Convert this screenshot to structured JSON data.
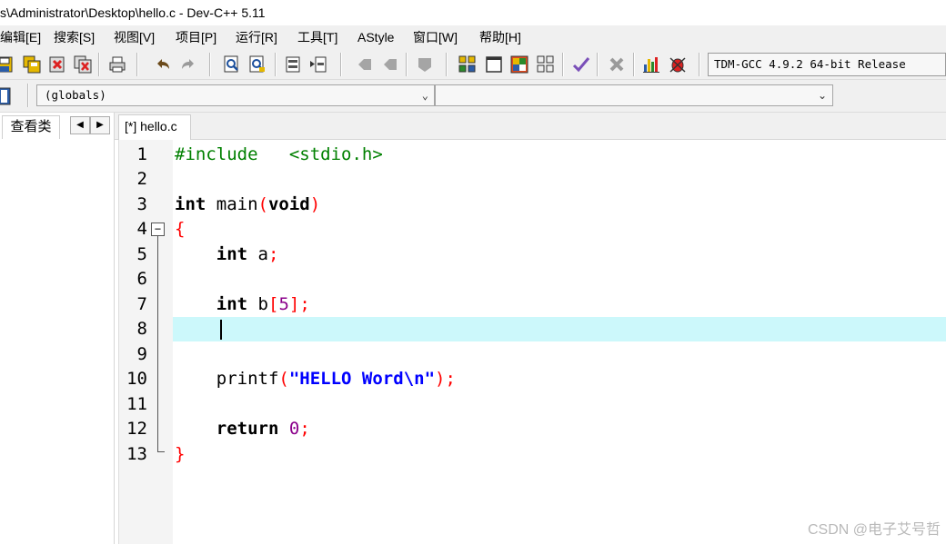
{
  "window": {
    "title": "s\\Administrator\\Desktop\\hello.c - Dev-C++ 5.11"
  },
  "menu": [
    "编辑[E]",
    "搜索[S]",
    "视图[V]",
    "项目[P]",
    "运行[R]",
    "工具[T]",
    "AStyle",
    "窗口[W]",
    "帮助[H]"
  ],
  "toolbar": {
    "compiler": "TDM-GCC 4.9.2 64-bit Release"
  },
  "classbar": {
    "scope": "(globals)",
    "members": ""
  },
  "left_panel": {
    "tab_label": "查看类"
  },
  "editor": {
    "file_tab": "[*] hello.c",
    "line_numbers": [
      "1",
      "2",
      "3",
      "4",
      "5",
      "6",
      "7",
      "8",
      "9",
      "10",
      "11",
      "12",
      "13"
    ],
    "current_line": "8",
    "lines": {
      "l1_directive": "#include",
      "l1_header": "<stdio.h>",
      "l3_int": "int",
      "l3_main": " main",
      "l3_paren_open": "(",
      "l3_void": "void",
      "l3_paren_close": ")",
      "l4_brace": "{",
      "l5_int": "int",
      "l5_var": " a",
      "l5_semi": ";",
      "l7_int": "int",
      "l7_var": " b",
      "l7_bracket_open": "[",
      "l7_num": "5",
      "l7_bracket_close": "]",
      "l7_semi": ";",
      "l10_func": "printf",
      "l10_paren_open": "(",
      "l10_string": "\"HELLO Word\\n\"",
      "l10_paren_close": ")",
      "l10_semi": ";",
      "l12_return": "return",
      "l12_num": "0",
      "l12_semi": ";",
      "l13_brace": "}"
    }
  },
  "watermark": "CSDN @电子艾号哲"
}
